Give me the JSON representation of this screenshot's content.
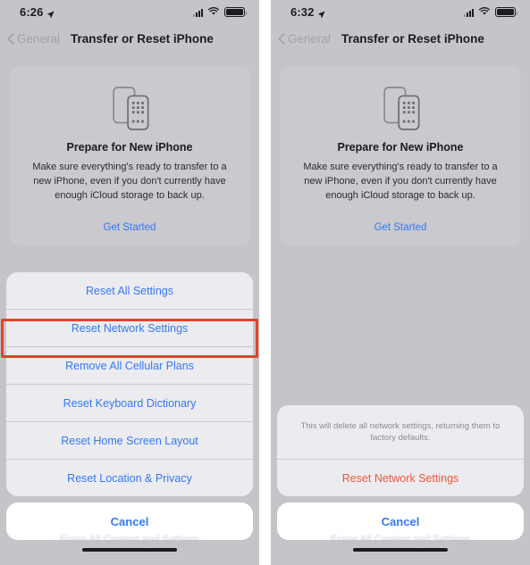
{
  "panels": [
    {
      "id": "left",
      "statusbar": {
        "time": "6:26",
        "location_icon": "location-arrow-icon",
        "cellular_icon": "cellular-bars-icon",
        "wifi_icon": "wifi-icon",
        "battery_icon": "battery-icon"
      },
      "navbar": {
        "back_label": "General",
        "back_icon": "chevron-left-icon",
        "title": "Transfer or Reset iPhone"
      },
      "card": {
        "icon": "two-iphones-icon",
        "title": "Prepare for New iPhone",
        "body": "Make sure everything's ready to transfer to a new iPhone, even if you don't currently have enough iCloud storage to back up.",
        "link": "Get Started"
      },
      "ghost_text": "Erase All Content and Settings",
      "sheet": {
        "header": null,
        "items": [
          {
            "label": "Reset All Settings",
            "style": "normal",
            "highlighted": false
          },
          {
            "label": "Reset Network Settings",
            "style": "normal",
            "highlighted": true
          },
          {
            "label": "Remove All Cellular Plans",
            "style": "normal",
            "highlighted": false
          },
          {
            "label": "Reset Keyboard Dictionary",
            "style": "normal",
            "highlighted": false
          },
          {
            "label": "Reset Home Screen Layout",
            "style": "normal",
            "highlighted": false
          },
          {
            "label": "Reset Location & Privacy",
            "style": "normal",
            "highlighted": false
          }
        ],
        "cancel_label": "Cancel"
      }
    },
    {
      "id": "right",
      "statusbar": {
        "time": "6:32",
        "location_icon": "location-arrow-icon",
        "cellular_icon": "cellular-bars-icon",
        "wifi_icon": "wifi-icon",
        "battery_icon": "battery-icon"
      },
      "navbar": {
        "back_label": "General",
        "back_icon": "chevron-left-icon",
        "title": "Transfer or Reset iPhone"
      },
      "card": {
        "icon": "two-iphones-icon",
        "title": "Prepare for New iPhone",
        "body": "Make sure everything's ready to transfer to a new iPhone, even if you don't currently have enough iCloud storage to back up.",
        "link": "Get Started"
      },
      "ghost_text": "Erase All Content and Settings",
      "sheet": {
        "header": "This will delete all network settings, returning them to factory defaults.",
        "items": [
          {
            "label": "Reset Network Settings",
            "style": "destructive",
            "highlighted": false
          }
        ],
        "cancel_label": "Cancel"
      }
    }
  ],
  "colors": {
    "accent_blue": "#3478f6",
    "destructive_red": "#f0563c",
    "highlight_red": "#e8402a",
    "dim_background": "#c4c4c9",
    "card_background": "#c9c9ce",
    "sheet_background": "#ececf0"
  }
}
